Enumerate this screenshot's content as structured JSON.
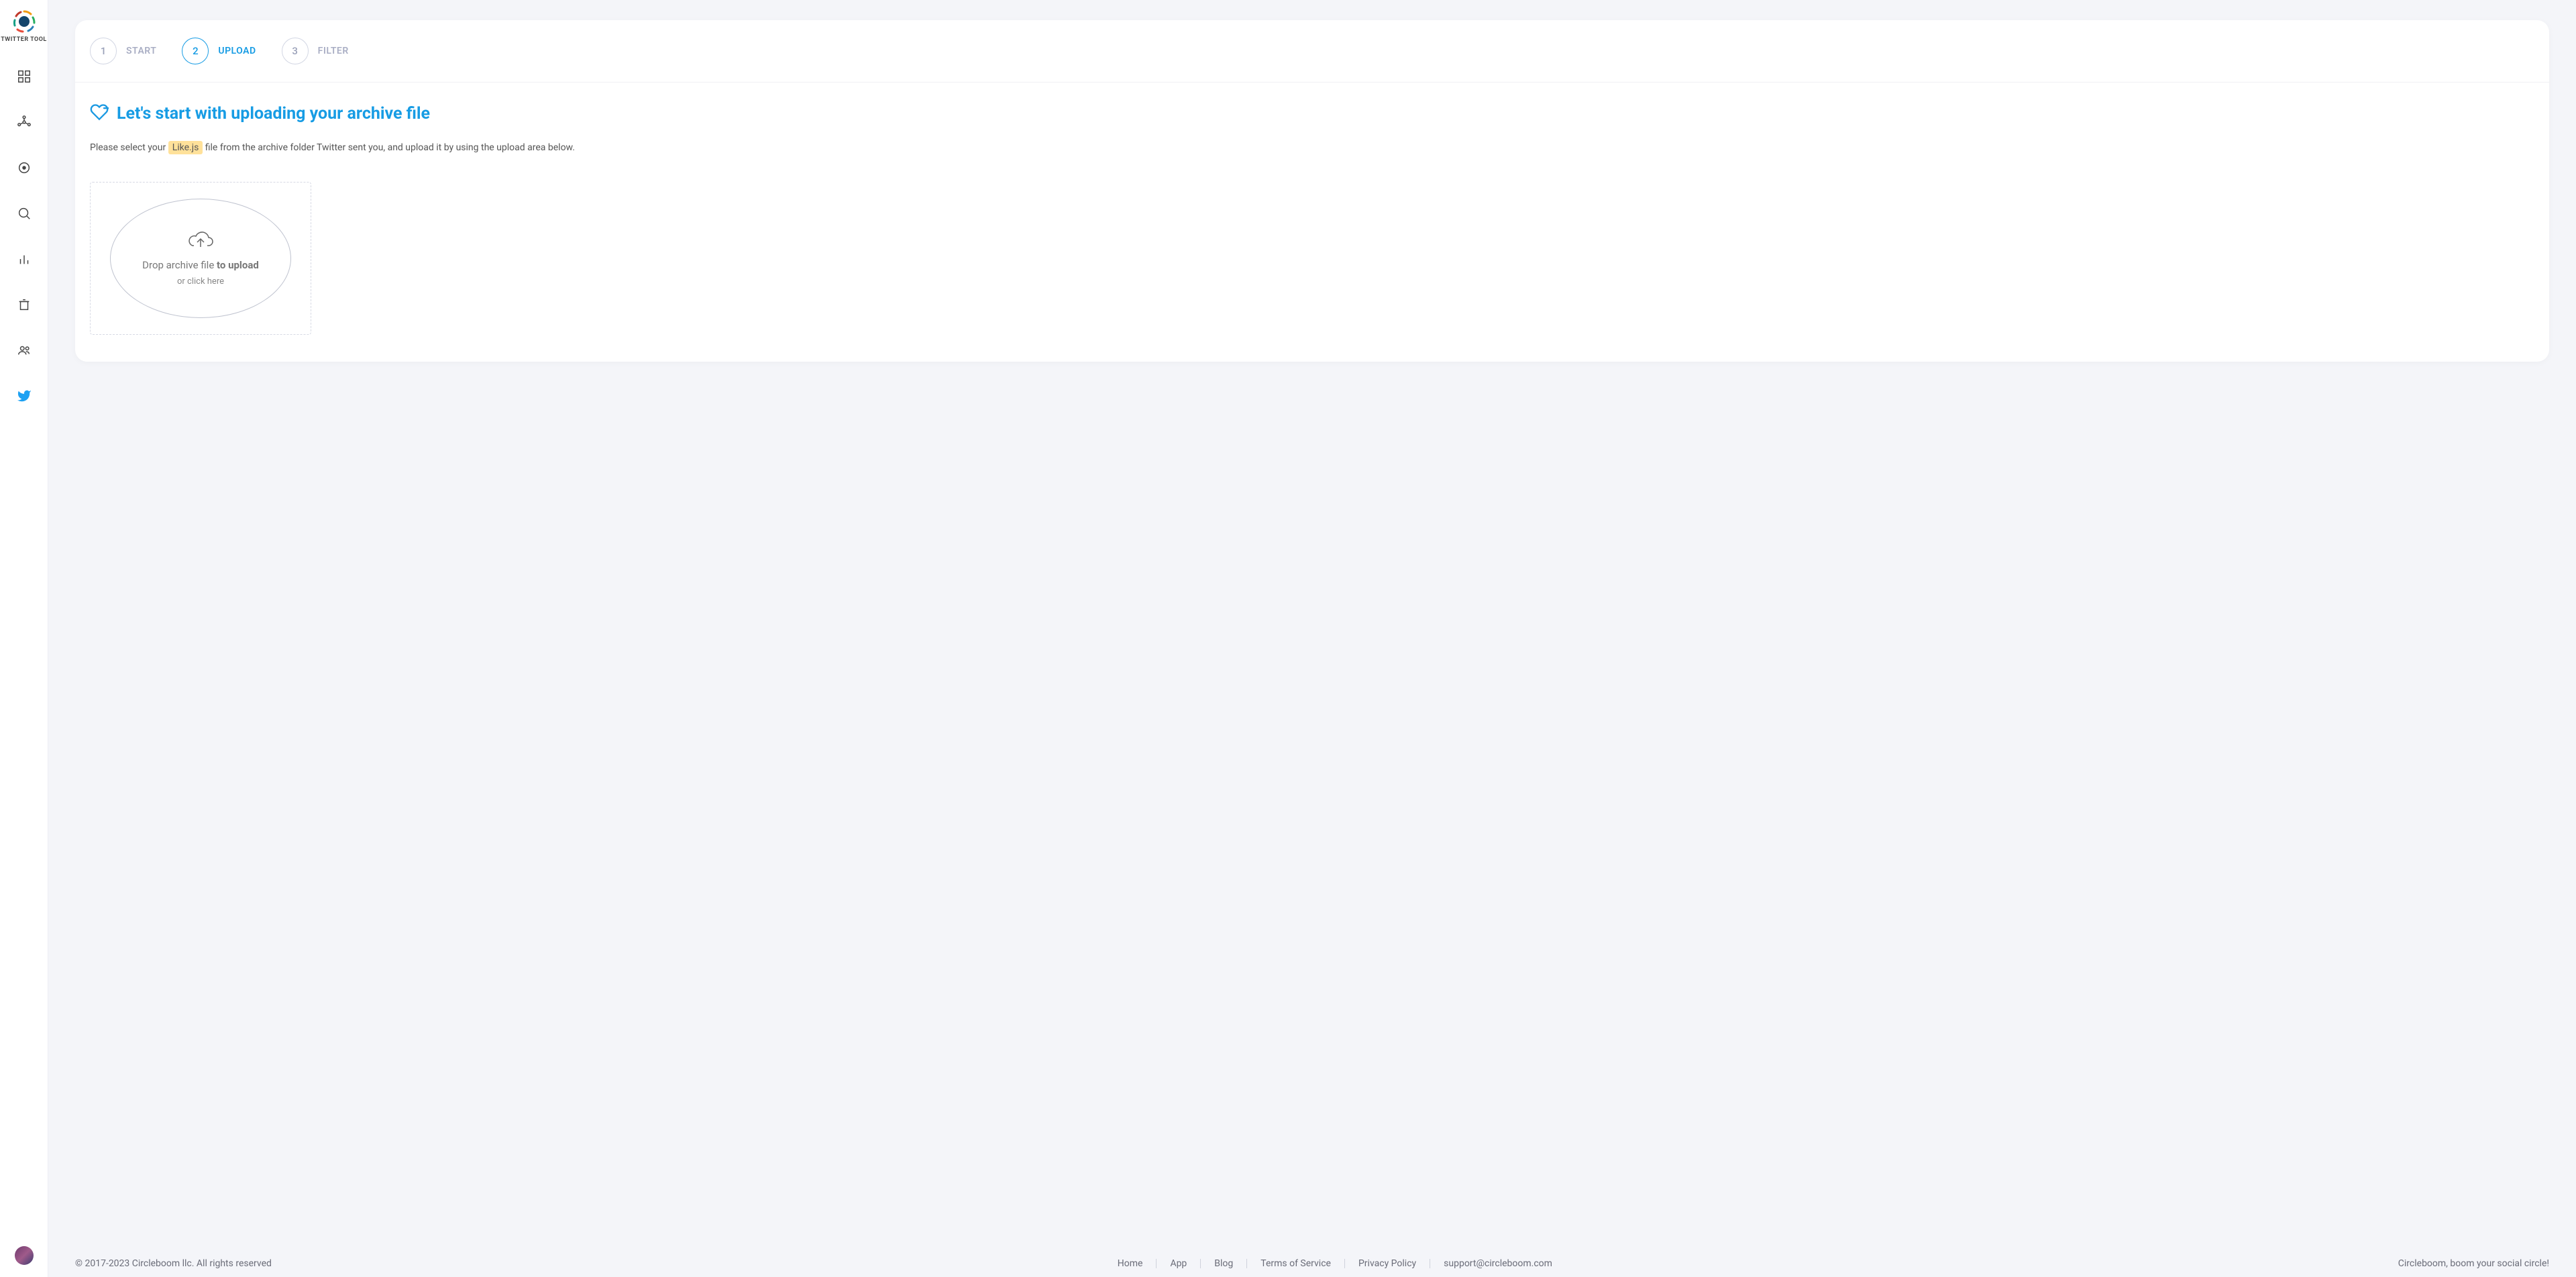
{
  "brand": {
    "name": "TWITTER TOOL"
  },
  "sidebar": {
    "items": [
      {
        "name": "dashboard-icon"
      },
      {
        "name": "network-icon"
      },
      {
        "name": "target-icon"
      },
      {
        "name": "search-icon"
      },
      {
        "name": "chart-icon"
      },
      {
        "name": "trash-icon"
      },
      {
        "name": "people-icon"
      },
      {
        "name": "twitter-icon"
      }
    ]
  },
  "stepper": {
    "steps": [
      {
        "num": "1",
        "label": "START"
      },
      {
        "num": "2",
        "label": "UPLOAD"
      },
      {
        "num": "3",
        "label": "FILTER"
      }
    ],
    "active_index": 1
  },
  "page": {
    "title": "Let's start with uploading your archive file",
    "desc_pre": "Please select your ",
    "desc_file": "Like.js",
    "desc_post": " file from the archive folder Twitter sent you, and upload it by using the upload area below.",
    "upload": {
      "line1_pre": "Drop archive file ",
      "line1_bold": "to upload",
      "sub": "or click here"
    }
  },
  "footer": {
    "copyright": "© 2017-2023 Circleboom llc. All rights reserved",
    "links": [
      "Home",
      "App",
      "Blog",
      "Terms of Service",
      "Privacy Policy",
      "support@circleboom.com"
    ],
    "tagline": "Circleboom, boom your social circle!"
  }
}
